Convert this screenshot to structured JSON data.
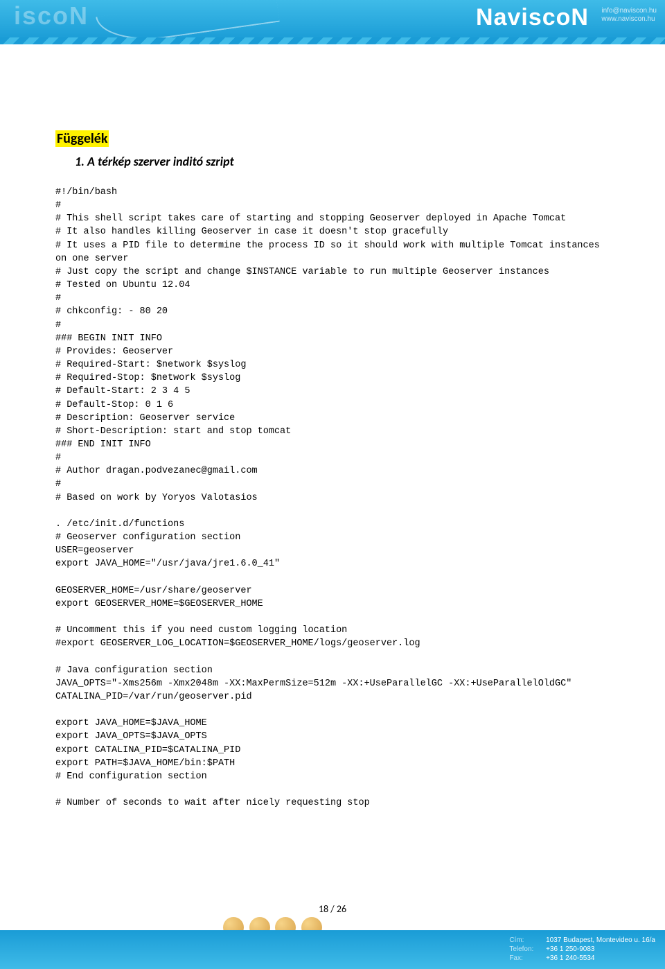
{
  "header": {
    "brand": "NaviscoN",
    "info_line1": "info@naviscon.hu",
    "info_line2": "www.naviscon.hu"
  },
  "doc": {
    "section_title": "Függelék",
    "subsection_title": "1.  A térkép szerver inditó szript",
    "code": "#!/bin/bash\n#\n# This shell script takes care of starting and stopping Geoserver deployed in Apache Tomcat\n# It also handles killing Geoserver in case it doesn't stop gracefully\n# It uses a PID file to determine the process ID so it should work with multiple Tomcat instances on one server\n# Just copy the script and change $INSTANCE variable to run multiple Geoserver instances\n# Tested on Ubuntu 12.04\n#\n# chkconfig: - 80 20\n#\n### BEGIN INIT INFO\n# Provides: Geoserver\n# Required-Start: $network $syslog\n# Required-Stop: $network $syslog\n# Default-Start: 2 3 4 5\n# Default-Stop: 0 1 6\n# Description: Geoserver service\n# Short-Description: start and stop tomcat\n### END INIT INFO\n#\n# Author dragan.podvezanec@gmail.com\n#\n# Based on work by Yoryos Valotasios\n\n. /etc/init.d/functions\n# Geoserver configuration section\nUSER=geoserver\nexport JAVA_HOME=\"/usr/java/jre1.6.0_41\"\n\nGEOSERVER_HOME=/usr/share/geoserver\nexport GEOSERVER_HOME=$GEOSERVER_HOME\n\n# Uncomment this if you need custom logging location\n#export GEOSERVER_LOG_LOCATION=$GEOSERVER_HOME/logs/geoserver.log\n\n# Java configuration section\nJAVA_OPTS=\"-Xms256m -Xmx2048m -XX:MaxPermSize=512m -XX:+UseParallelGC -XX:+UseParallelOldGC\"\nCATALINA_PID=/var/run/geoserver.pid\n\nexport JAVA_HOME=$JAVA_HOME\nexport JAVA_OPTS=$JAVA_OPTS\nexport CATALINA_PID=$CATALINA_PID\nexport PATH=$JAVA_HOME/bin:$PATH\n# End configuration section\n\n# Number of seconds to wait after nicely requesting stop",
    "page_number": "18 / 26"
  },
  "footer": {
    "addr_label": "Cím:",
    "addr_value": "1037 Budapest, Montevideo u. 16/a",
    "tel_label": "Telefon:",
    "tel_value": "+36 1 250-9083",
    "fax_label": "Fax:",
    "fax_value": "+36 1 240-5534"
  }
}
